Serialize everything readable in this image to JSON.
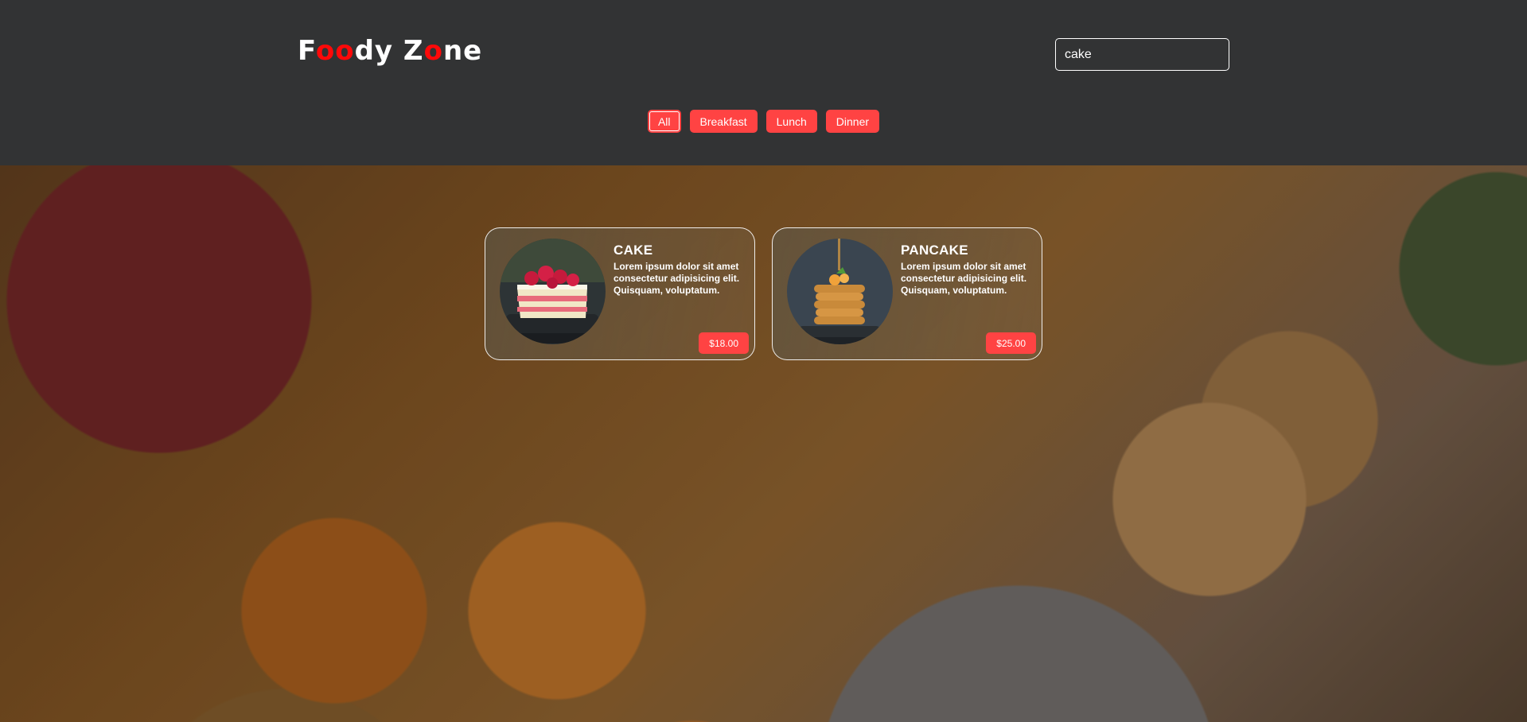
{
  "header": {
    "logo_parts": [
      "F",
      "oo",
      "dy Z",
      "o",
      "ne"
    ],
    "search": {
      "value": "cake"
    }
  },
  "filters": [
    {
      "label": "All",
      "active": true
    },
    {
      "label": "Breakfast",
      "active": false
    },
    {
      "label": "Lunch",
      "active": false
    },
    {
      "label": "Dinner",
      "active": false
    }
  ],
  "cards": [
    {
      "title": "CAKE",
      "description": "Lorem ipsum dolor sit amet consectetur adipisicing elit. Quisquam, voluptatum.",
      "price": "$18.00"
    },
    {
      "title": "PANCAKE",
      "description": "Lorem ipsum dolor sit amet consectetur adipisicing elit. Quisquam, voluptatum.",
      "price": "$25.00"
    }
  ],
  "colors": {
    "accent": "#ff4343",
    "logo_accent": "#ff0909",
    "header_bg": "#323334"
  }
}
